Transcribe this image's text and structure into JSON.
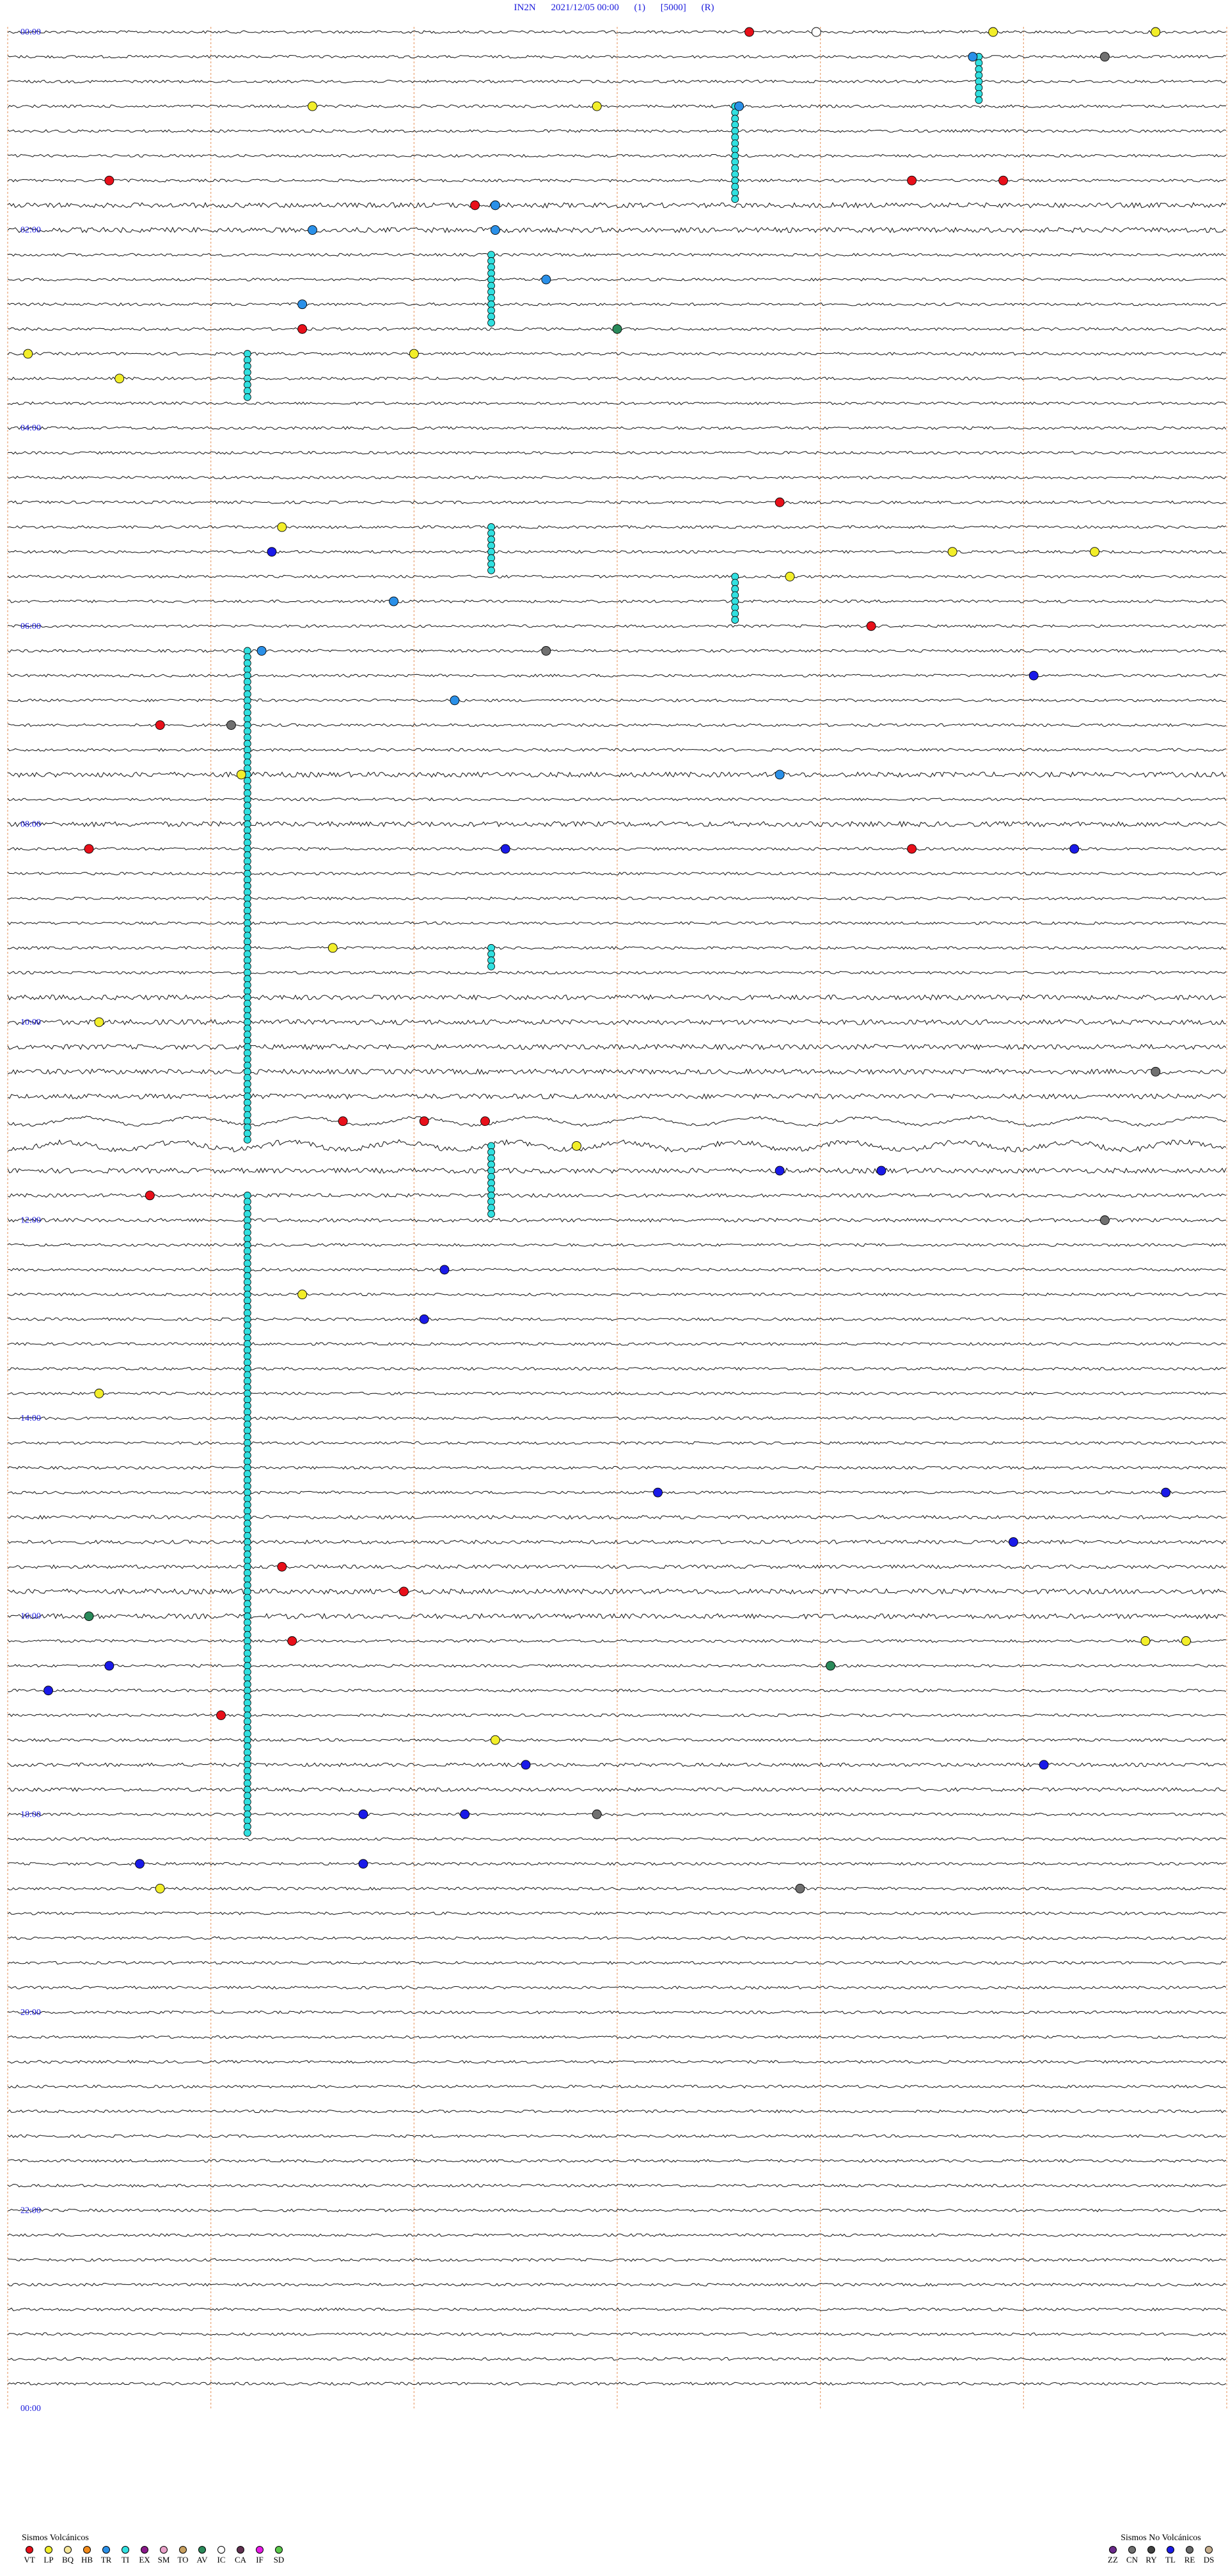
{
  "header": {
    "station": "IN2N",
    "datetime": "2021/12/05 00:00",
    "channel": "(1)",
    "gain": "[5000]",
    "flag": "(R)"
  },
  "chart_data": {
    "type": "seismogram",
    "traces_per_hour": 4,
    "hours": 24,
    "time_labels": [
      "00:00",
      "02:00",
      "04:00",
      "06:00",
      "08:00",
      "10:00",
      "12:00",
      "14:00",
      "16:00",
      "18:00",
      "20:00",
      "22:00",
      "00:00"
    ],
    "minute_marks": [
      0,
      10,
      20,
      30,
      40,
      50,
      60
    ],
    "events": [
      {
        "row": 0,
        "minute": 36.5,
        "type": "VT"
      },
      {
        "row": 0,
        "minute": 39.8,
        "type": "IC"
      },
      {
        "row": 0,
        "minute": 48.5,
        "type": "LP"
      },
      {
        "row": 0,
        "minute": 56.5,
        "type": "LP"
      },
      {
        "row": 1,
        "minute": 47.5,
        "type": "TR"
      },
      {
        "row": 1,
        "minute": 54,
        "type": "CN"
      },
      {
        "row": 3,
        "minute": 15,
        "type": "LP"
      },
      {
        "row": 3,
        "minute": 29,
        "type": "LP"
      },
      {
        "row": 3,
        "minute": 36,
        "type": "TR"
      },
      {
        "row": 6,
        "minute": 5,
        "type": "VT"
      },
      {
        "row": 6,
        "minute": 44.5,
        "type": "VT"
      },
      {
        "row": 6,
        "minute": 49,
        "type": "VT"
      },
      {
        "row": 7,
        "minute": 23,
        "type": "VT"
      },
      {
        "row": 7,
        "minute": 24,
        "type": "TR"
      },
      {
        "row": 8,
        "minute": 24,
        "type": "TR"
      },
      {
        "row": 8,
        "minute": 15,
        "type": "TR"
      },
      {
        "row": 10,
        "minute": 26.5,
        "type": "TR"
      },
      {
        "row": 11,
        "minute": 14.5,
        "type": "TR"
      },
      {
        "row": 12,
        "minute": 14.5,
        "type": "VT"
      },
      {
        "row": 12,
        "minute": 30,
        "type": "AV"
      },
      {
        "row": 13,
        "minute": 20,
        "type": "LP"
      },
      {
        "row": 13,
        "minute": 1,
        "type": "LP"
      },
      {
        "row": 14,
        "minute": 5.5,
        "type": "LP"
      },
      {
        "row": 19,
        "minute": 38,
        "type": "VT"
      },
      {
        "row": 20,
        "minute": 13.5,
        "type": "LP"
      },
      {
        "row": 21,
        "minute": 13,
        "type": "TL"
      },
      {
        "row": 21,
        "minute": 46.5,
        "type": "LP"
      },
      {
        "row": 21,
        "minute": 53.5,
        "type": "LP"
      },
      {
        "row": 22,
        "minute": 38.5,
        "type": "LP"
      },
      {
        "row": 23,
        "minute": 19,
        "type": "TR"
      },
      {
        "row": 24,
        "minute": 42.5,
        "type": "VT"
      },
      {
        "row": 25,
        "minute": 26.5,
        "type": "CN"
      },
      {
        "row": 25,
        "minute": 12.5,
        "type": "TR"
      },
      {
        "row": 26,
        "minute": 50.5,
        "type": "TL"
      },
      {
        "row": 27,
        "minute": 22,
        "type": "TR"
      },
      {
        "row": 28,
        "minute": 7.5,
        "type": "VT"
      },
      {
        "row": 28,
        "minute": 11,
        "type": "CN"
      },
      {
        "row": 30,
        "minute": 11.5,
        "type": "LP"
      },
      {
        "row": 30,
        "minute": 38,
        "type": "TR"
      },
      {
        "row": 33,
        "minute": 4,
        "type": "VT"
      },
      {
        "row": 33,
        "minute": 24.5,
        "type": "TL"
      },
      {
        "row": 33,
        "minute": 44.5,
        "type": "VT"
      },
      {
        "row": 33,
        "minute": 52.5,
        "type": "TL"
      },
      {
        "row": 37,
        "minute": 16,
        "type": "LP"
      },
      {
        "row": 40,
        "minute": 4.5,
        "type": "LP"
      },
      {
        "row": 42,
        "minute": 56.5,
        "type": "CN"
      },
      {
        "row": 44,
        "minute": 16.5,
        "type": "VT"
      },
      {
        "row": 44,
        "minute": 20.5,
        "type": "VT"
      },
      {
        "row": 44,
        "minute": 23.5,
        "type": "VT"
      },
      {
        "row": 45,
        "minute": 28,
        "type": "LP"
      },
      {
        "row": 46,
        "minute": 38,
        "type": "TL"
      },
      {
        "row": 46,
        "minute": 43,
        "type": "TL"
      },
      {
        "row": 47,
        "minute": 7,
        "type": "VT"
      },
      {
        "row": 48,
        "minute": 54,
        "type": "CN"
      },
      {
        "row": 50,
        "minute": 21.5,
        "type": "TL"
      },
      {
        "row": 51,
        "minute": 14.5,
        "type": "LP"
      },
      {
        "row": 52,
        "minute": 20.5,
        "type": "TL"
      },
      {
        "row": 55,
        "minute": 4.5,
        "type": "LP"
      },
      {
        "row": 59,
        "minute": 32,
        "type": "TL"
      },
      {
        "row": 59,
        "minute": 57,
        "type": "TL"
      },
      {
        "row": 61,
        "minute": 49.5,
        "type": "TL"
      },
      {
        "row": 62,
        "minute": 13.5,
        "type": "VT"
      },
      {
        "row": 63,
        "minute": 19.5,
        "type": "VT"
      },
      {
        "row": 64,
        "minute": 4,
        "type": "AV"
      },
      {
        "row": 65,
        "minute": 14,
        "type": "VT"
      },
      {
        "row": 65,
        "minute": 56,
        "type": "LP"
      },
      {
        "row": 65,
        "minute": 58,
        "type": "LP"
      },
      {
        "row": 66,
        "minute": 5,
        "type": "TL"
      },
      {
        "row": 66,
        "minute": 40.5,
        "type": "AV"
      },
      {
        "row": 67,
        "minute": 2,
        "type": "TL"
      },
      {
        "row": 68,
        "minute": 10.5,
        "type": "VT"
      },
      {
        "row": 69,
        "minute": 24,
        "type": "LP"
      },
      {
        "row": 70,
        "minute": 25.5,
        "type": "TL"
      },
      {
        "row": 70,
        "minute": 51,
        "type": "TL"
      },
      {
        "row": 72,
        "minute": 17.5,
        "type": "TL"
      },
      {
        "row": 72,
        "minute": 22.5,
        "type": "TL"
      },
      {
        "row": 72,
        "minute": 29,
        "type": "CN"
      },
      {
        "row": 74,
        "minute": 6.5,
        "type": "TL"
      },
      {
        "row": 74,
        "minute": 17.5,
        "type": "TL"
      },
      {
        "row": 75,
        "minute": 7.5,
        "type": "LP"
      },
      {
        "row": 75,
        "minute": 39,
        "type": "CN"
      }
    ],
    "tremor_columns": [
      {
        "minute": 23.8,
        "row_start": 9,
        "row_end": 11
      },
      {
        "minute": 35.8,
        "row_start": 3,
        "row_end": 6
      },
      {
        "minute": 47.8,
        "row_start": 1,
        "row_end": 2
      },
      {
        "minute": 11.8,
        "row_start": 13,
        "row_end": 14
      },
      {
        "minute": 23.8,
        "row_start": 20,
        "row_end": 21
      },
      {
        "minute": 35.8,
        "row_start": 22,
        "row_end": 23
      },
      {
        "minute": 11.8,
        "row_start": 25,
        "row_end": 37
      },
      {
        "minute": 23.8,
        "row_start": 37,
        "row_end": 37
      },
      {
        "minute": 11.8,
        "row_start": 38,
        "row_end": 44
      },
      {
        "minute": 23.8,
        "row_start": 45,
        "row_end": 47
      },
      {
        "minute": 11.8,
        "row_start": 47,
        "row_end": 61
      },
      {
        "minute": 11.8,
        "row_start": 62,
        "row_end": 72
      }
    ],
    "legend_volcanic": {
      "title": "Sismos Volcánicos",
      "items": [
        {
          "code": "VT",
          "color": "#e8101a"
        },
        {
          "code": "LP",
          "color": "#f2ee2a"
        },
        {
          "code": "BQ",
          "color": "#f7e79a"
        },
        {
          "code": "HB",
          "color": "#f08a1a"
        },
        {
          "code": "TR",
          "color": "#2a90e8"
        },
        {
          "code": "TI",
          "color": "#31e0e0"
        },
        {
          "code": "EX",
          "color": "#8a1a8a"
        },
        {
          "code": "SM",
          "color": "#e8a0c8"
        },
        {
          "code": "TO",
          "color": "#c8a060"
        },
        {
          "code": "AV",
          "color": "#2a8a5a"
        },
        {
          "code": "IC",
          "color": "#ffffff"
        },
        {
          "code": "CA",
          "color": "#603050"
        },
        {
          "code": "IF",
          "color": "#e81ae8"
        },
        {
          "code": "SD",
          "color": "#5ac84a"
        }
      ]
    },
    "legend_nonvolcanic": {
      "title": "Sismos No Volcánicos",
      "items": [
        {
          "code": "ZZ",
          "color": "#6a2a8a"
        },
        {
          "code": "CN",
          "color": "#707070"
        },
        {
          "code": "RY",
          "color": "#404040"
        },
        {
          "code": "TL",
          "color": "#1a1ae8"
        },
        {
          "code": "RE",
          "color": "#6a6a6a"
        },
        {
          "code": "DS",
          "color": "#c8b090"
        }
      ]
    },
    "colors": {
      "trace": "#111111",
      "time_label": "#1a1adc",
      "minute_line": "#e8a070"
    }
  }
}
